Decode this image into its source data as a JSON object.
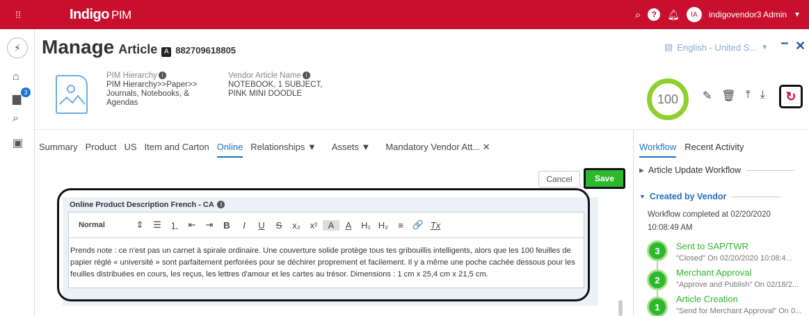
{
  "topbar": {
    "brand": "Indigo",
    "brand_suffix": "PIM",
    "user_initials": "IA",
    "user_name": "indigovendor3 Admin",
    "caret": "▼",
    "help_glyph": "?"
  },
  "rail": {
    "notification_count": "3"
  },
  "header": {
    "manage": "Manage",
    "entity": "Article",
    "badge": "A",
    "article_number": "882709618805",
    "language": "English - United S...",
    "language_caret": "▼"
  },
  "fields": {
    "hierarchy_label": "PIM Hierarchy",
    "hierarchy_lines": [
      "PIM Hierarchy>>Paper>>",
      "Journals, Notebooks, &",
      "Agendas"
    ],
    "vendor_name_label": "Vendor Article Name",
    "vendor_name_lines": [
      "NOTEBOOK, 1 SUBJECT,",
      "PINK MINI DOODLE"
    ],
    "info_glyph": "i"
  },
  "score": "100",
  "tabs": [
    {
      "label": "Summary"
    },
    {
      "label": "Product"
    },
    {
      "label": "US"
    },
    {
      "label": "Item and Carton"
    },
    {
      "label": "Online"
    },
    {
      "label": "Relationships ▼"
    },
    {
      "label": "Assets ▼"
    },
    {
      "label": "Mandatory Vendor Att... ✕"
    }
  ],
  "buttons": {
    "cancel": "Cancel",
    "save": "Save"
  },
  "editor": {
    "label": "Online Product Description French - CA",
    "format": "Normal",
    "format_caret": "⇕",
    "toolbar_glyphs": [
      "☰",
      "⒈",
      "⇤",
      "⇥",
      "B",
      "I",
      "U",
      "S",
      "x₂",
      "x²",
      "A",
      "A",
      "H₁",
      "H₂",
      "≡",
      "🔗",
      "Tx"
    ],
    "text": "Prends note : ce n'est pas un carnet à spirale ordinaire. Une couverture solide protège tous tes gribouillis intelligents, alors que les 100 feuilles de papier réglé « université » sont parfaitement perforées pour se déchirer proprement et facilement. Il y a même une poche cachée dessous pour les feuilles distribuées en cours, les reçus, les lettres d'amour et les cartes au trésor. Dimensions : 1 cm x 25,4 cm x 21,5 cm."
  },
  "right_panel": {
    "tabs": [
      "Workflow",
      "Recent Activity"
    ],
    "article_update": "Article Update Workflow",
    "created_by": "Created by Vendor",
    "completed_line1": "Workflow completed at 02/20/2020",
    "completed_line2": "10:08:49 AM",
    "steps": [
      {
        "num": "3",
        "title": "Sent to SAP/TWR",
        "sub": "\"Closed\" On 02/20/2020 10:08:4..."
      },
      {
        "num": "2",
        "title": "Merchant Approval",
        "sub": "\"Approve and Publish\" On 02/18/2..."
      },
      {
        "num": "1",
        "title": "Article Creation",
        "sub": "\"Send for Merchant Approval\" On 0..."
      }
    ]
  }
}
